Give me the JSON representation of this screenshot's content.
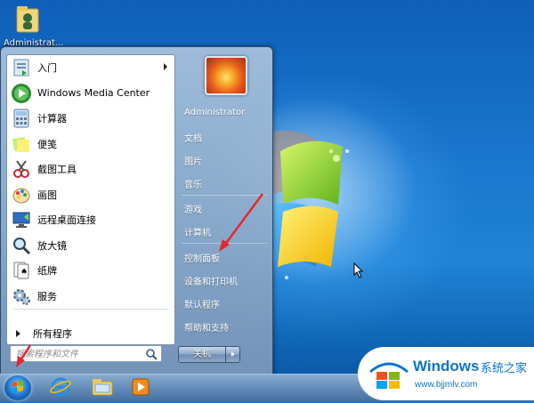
{
  "desktop": {
    "icon_label": "Administrat..."
  },
  "start_menu": {
    "programs": [
      {
        "label": "入门",
        "icon": "getting-started-icon",
        "has_submenu": true
      },
      {
        "label": "Windows Media Center",
        "icon": "media-center-icon",
        "has_submenu": false
      },
      {
        "label": "计算器",
        "icon": "calculator-icon",
        "has_submenu": false
      },
      {
        "label": "便笺",
        "icon": "sticky-notes-icon",
        "has_submenu": false
      },
      {
        "label": "截图工具",
        "icon": "snipping-tool-icon",
        "has_submenu": false
      },
      {
        "label": "画图",
        "icon": "paint-icon",
        "has_submenu": false
      },
      {
        "label": "远程桌面连接",
        "icon": "remote-desktop-icon",
        "has_submenu": false
      },
      {
        "label": "放大镜",
        "icon": "magnifier-icon",
        "has_submenu": false
      },
      {
        "label": "纸牌",
        "icon": "solitaire-icon",
        "has_submenu": false
      },
      {
        "label": "服务",
        "icon": "services-icon",
        "has_submenu": false
      }
    ],
    "all_programs": "所有程序",
    "search_placeholder": "搜索程序和文件",
    "right_items": {
      "user": "Administrator",
      "documents": "文档",
      "pictures": "图片",
      "music": "音乐",
      "games": "游戏",
      "computer": "计算机",
      "control_panel": "控制面板",
      "devices_printers": "设备和打印机",
      "default_programs": "默认程序",
      "help_support": "帮助和支持"
    },
    "shutdown_label": "关机"
  },
  "watermark": {
    "brand": "Windows",
    "cn": "系统之家",
    "url": "www.bjjmlv.com"
  },
  "colors": {
    "annotation_arrow": "#e8262b",
    "brand_blue": "#0a74d2"
  }
}
